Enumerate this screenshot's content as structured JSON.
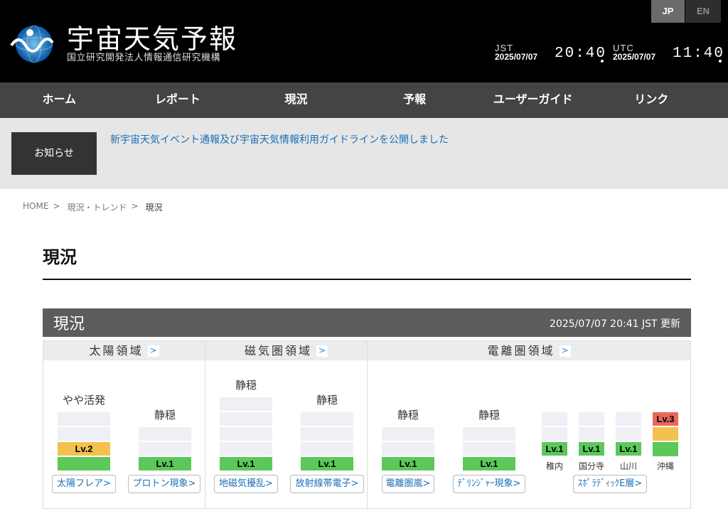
{
  "header": {
    "title": "宇宙天気予報",
    "subtitle": "国立研究開発法人情報通信研究機構",
    "lang_jp": "JP",
    "lang_en": "EN",
    "jst_label": "JST",
    "jst_date": "2025/07/07",
    "jst_time": "20:40",
    "utc_label": "UTC",
    "utc_date": "2025/07/07",
    "utc_time": "11:40"
  },
  "nav": [
    "ホーム",
    "レポート",
    "現況",
    "予報",
    "ユーザーガイド",
    "リンク"
  ],
  "notice": {
    "label": "お知らせ",
    "text": "新宇宙天気イベント通報及び宇宙天気情報利用ガイドラインを公開しました"
  },
  "breadcrumb": {
    "home": "HOME",
    "sep": ">",
    "trend": "現況・トレンド",
    "current": "現況"
  },
  "page_title": "現況",
  "panel": {
    "title": "現況",
    "updated": "2025/07/07 20:41 JST 更新",
    "arrow": ">",
    "columns": {
      "solar": "太陽領域",
      "magneto": "磁気圏領域",
      "iono": "電離圏領域"
    },
    "items": [
      {
        "status": "やや活発",
        "level": "Lv.2",
        "level_value": 2,
        "button": "太陽フレア>"
      },
      {
        "status": "静穏",
        "level": "Lv.1",
        "level_value": 1,
        "button": "プロトン現象>"
      },
      {
        "status": "静穏",
        "level": "Lv.1",
        "level_value": 1,
        "button": "地磁気擾乱>"
      },
      {
        "status": "静穏",
        "level": "Lv.1",
        "level_value": 1,
        "button": "放射線帯電子>"
      },
      {
        "status": "静穏",
        "level": "Lv.1",
        "level_value": 1,
        "button": "電離圏嵐>"
      },
      {
        "status": "静穏",
        "level": "Lv.1",
        "level_value": 1,
        "button": "ﾃﾞﾘﾝｼﾞｬｰ現象>"
      }
    ],
    "stations": [
      {
        "name": "稚内",
        "level": "Lv.1",
        "level_value": 1
      },
      {
        "name": "国分寺",
        "level": "Lv.1",
        "level_value": 1
      },
      {
        "name": "山川",
        "level": "Lv.1",
        "level_value": 1
      },
      {
        "name": "沖縄",
        "level": "Lv.3",
        "level_value": 3
      }
    ],
    "sporadic_button": "ｽﾎﾟﾗﾃﾞｨｯｸE層>"
  },
  "colors": {
    "level1": "#5cc85a",
    "level2": "#f4c04e",
    "level3": "#e7675a",
    "link": "#1a6fb6"
  }
}
